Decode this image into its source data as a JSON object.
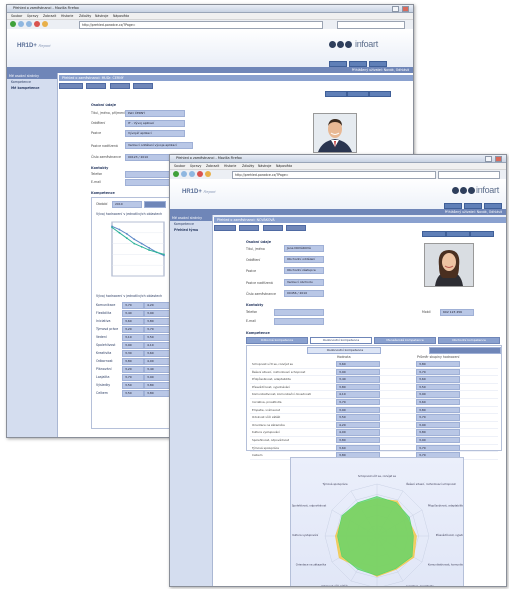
{
  "back_window": {
    "title": "Přehled o zaměstnanci - Mozilla Firefox",
    "menu": [
      "Soubor",
      "Úpravy",
      "Zobrazit",
      "Historie",
      "Záložky",
      "Nástroje",
      "Nápověda"
    ],
    "url": "http://prehled.poradce.cz/?Page=",
    "sidebar_header": "Mé osobní stránky",
    "sidebar_items": [
      "Kompetence",
      "Mé kompetence"
    ],
    "breadcrumb": "Přehled o zaměstnanci: MUDr. ČERNÝ",
    "section_personal": "Osobní údaje",
    "personal_rows": [
      {
        "label": "Titul, jméno, příjmení",
        "value": "Petr ČERNÝ"
      },
      {
        "label": "Oddělení",
        "value": "IT - Vývoj aplikací"
      },
      {
        "label": "Pozice",
        "value": "Vývojář aplikací"
      },
      {
        "label": "Pozice nadřízená",
        "value": "Vedoucí oddělení vývoje aplikací"
      },
      {
        "label": "Číslo zaměstnance",
        "value": "00123 / 2010"
      }
    ],
    "section_contact": "Kontakty",
    "contact_rows": [
      {
        "label": "Telefon",
        "value": ""
      },
      {
        "label": "E-mail",
        "value": ""
      }
    ],
    "section_competence": "Kompetence",
    "filter_label": "Období",
    "filter_value": "2010",
    "chart_caption": "Vývoj hodnocení v jednotlivých oblastech",
    "table_caption": "Vývoj hodnocení v jednotlivých oblastech",
    "table_rows": [
      {
        "name": "Komunikace",
        "a": "3,70",
        "b": "4,20"
      },
      {
        "name": "Flexibilita",
        "a": "3,40",
        "b": "3,90"
      },
      {
        "name": "Iniciativa",
        "a": "3,60",
        "b": "3,80"
      },
      {
        "name": "Týmová práce",
        "a": "3,20",
        "b": "3,70"
      },
      {
        "name": "Vedení",
        "a": "3,10",
        "b": "3,50"
      },
      {
        "name": "Spolehlivost",
        "a": "3,90",
        "b": "4,10"
      },
      {
        "name": "Kreativita",
        "a": "3,30",
        "b": "3,60"
      },
      {
        "name": "Odbornost",
        "a": "3,80",
        "b": "4,00"
      },
      {
        "name": "Plánování",
        "a": "3,20",
        "b": "3,40"
      },
      {
        "name": "Loajalita",
        "a": "3,70",
        "b": "3,90"
      },
      {
        "name": "Výsledky",
        "a": "3,50",
        "b": "3,80"
      },
      {
        "name": "Celkem",
        "a": "3,50",
        "b": "3,80"
      }
    ]
  },
  "front_window": {
    "title": "Přehled o zaměstnanci - Mozilla Firefox",
    "menu": [
      "Soubor",
      "Úpravy",
      "Zobrazit",
      "Historie",
      "Záložky",
      "Nástroje",
      "Nápověda"
    ],
    "url": "http://prehled.poradce.cz/?Page=",
    "logo_left": "HR1D+",
    "logo_left_sub": "Report",
    "logo_right": "infoart",
    "user_bar": "Přihlášený uživatel: Novák, Odhlásit",
    "sidebar_header": "Mé osobní stránky",
    "sidebar_items": [
      "Kompetence",
      "Přehled týmu"
    ],
    "breadcrumb": "Přehled o zaměstnanci: NOVÁKOVÁ",
    "section_personal": "Osobní údaje",
    "personal_rows": [
      {
        "label": "Titul, jméno",
        "value": "Jana NOVÁKOVÁ"
      },
      {
        "label": "Oddělení",
        "value": "Obchodní oddělení"
      },
      {
        "label": "Pozice",
        "value": "Obchodní zástupce"
      },
      {
        "label": "Pozice nadřízená",
        "value": "Vedoucí obchodu"
      },
      {
        "label": "Číslo zaměstnance",
        "value": "00456 / 2010"
      }
    ],
    "section_contact": "Kontakty",
    "contact_rows": [
      {
        "label": "Telefon",
        "value": ""
      },
      {
        "label": "E-mail",
        "value": ""
      }
    ],
    "phone_right_label": "Mobil",
    "phone_right_value": "602 123 456",
    "section_competence": "Kompetence",
    "skill_tabs": [
      "Odborné kompetence",
      "Osobnostní kompetence",
      "Manažerské kompetence",
      "Obchodní kompetence"
    ],
    "active_tab": 1,
    "table_title": "Osobnostní kompetence",
    "col_a": "Hodnota",
    "col_b": "Průměr skupiny hodnocení",
    "rows": [
      {
        "name": "Schopnost učit se, rozvíjet se",
        "a": "3,60",
        "b": "3,80"
      },
      {
        "name": "Řešení situací, rozhodovací schopnost",
        "a": "3,90",
        "b": "3,70"
      },
      {
        "name": "Přizpůsobivost, adaptabilita",
        "a": "3,40",
        "b": "3,60"
      },
      {
        "name": "Přesvědčivost, vyjednávání",
        "a": "3,80",
        "b": "3,50"
      },
      {
        "name": "Komunikativnost, komunikační dovednosti",
        "a": "4,10",
        "b": "3,90"
      },
      {
        "name": "Iniciativa, proaktivita",
        "a": "3,70",
        "b": "3,60"
      },
      {
        "name": "Empatie, vnímavost",
        "a": "3,90",
        "b": "3,80"
      },
      {
        "name": "Odolnost vůči zátěži",
        "a": "3,50",
        "b": "3,70"
      },
      {
        "name": "Orientace na zákazníka",
        "a": "4,20",
        "b": "3,90"
      },
      {
        "name": "Kultura vystupování",
        "a": "4,00",
        "b": "3,80"
      },
      {
        "name": "Spolehlivost, odpovědnost",
        "a": "3,80",
        "b": "3,90"
      },
      {
        "name": "Týmová spolupráce",
        "a": "3,60",
        "b": "3,70"
      },
      {
        "name": "Celkem",
        "a": "3,80",
        "b": "3,70"
      }
    ]
  },
  "chart_data": [
    {
      "type": "line",
      "title": "",
      "x": [
        1,
        2,
        3,
        4,
        5,
        6,
        7,
        8
      ],
      "series": [
        {
          "name": "",
          "values": [
            4.6,
            4.3,
            3.9,
            3.4,
            3.0,
            2.6,
            2.2,
            1.9
          ]
        },
        {
          "name": "",
          "values": [
            4.5,
            4.0,
            3.5,
            3.0,
            2.7,
            2.4,
            2.2,
            2.0
          ]
        }
      ],
      "ylim": [
        0,
        5
      ]
    },
    {
      "type": "radar",
      "title": "",
      "categories": [
        "Schopnost učit se, rozvíjet se",
        "Řešení situací, rozhodovací schopnost",
        "Přizpůsobivost, adaptabilita",
        "Přesvědčivost, vyjednávání",
        "Komunikativnost, komunikační dovednosti",
        "Iniciativa, proaktivita",
        "Empatie, vnímavost",
        "Odolnost vůči zátěži",
        "Orientace na zákazníka",
        "Kultura vystupování",
        "Spolehlivost, odpovědnost",
        "Týmová spolupráce"
      ],
      "series": [
        {
          "name": "",
          "values": [
            3.6,
            3.9,
            3.4,
            3.8,
            4.1,
            3.7,
            3.9,
            3.5,
            4.2,
            4.0,
            3.8,
            3.6
          ],
          "color": "#f2c94c"
        },
        {
          "name": "",
          "values": [
            3.8,
            3.7,
            3.6,
            3.5,
            3.9,
            3.6,
            3.8,
            3.7,
            3.9,
            3.8,
            3.9,
            3.7
          ],
          "color": "#57d46a"
        }
      ],
      "rlim": [
        0,
        5
      ]
    }
  ]
}
